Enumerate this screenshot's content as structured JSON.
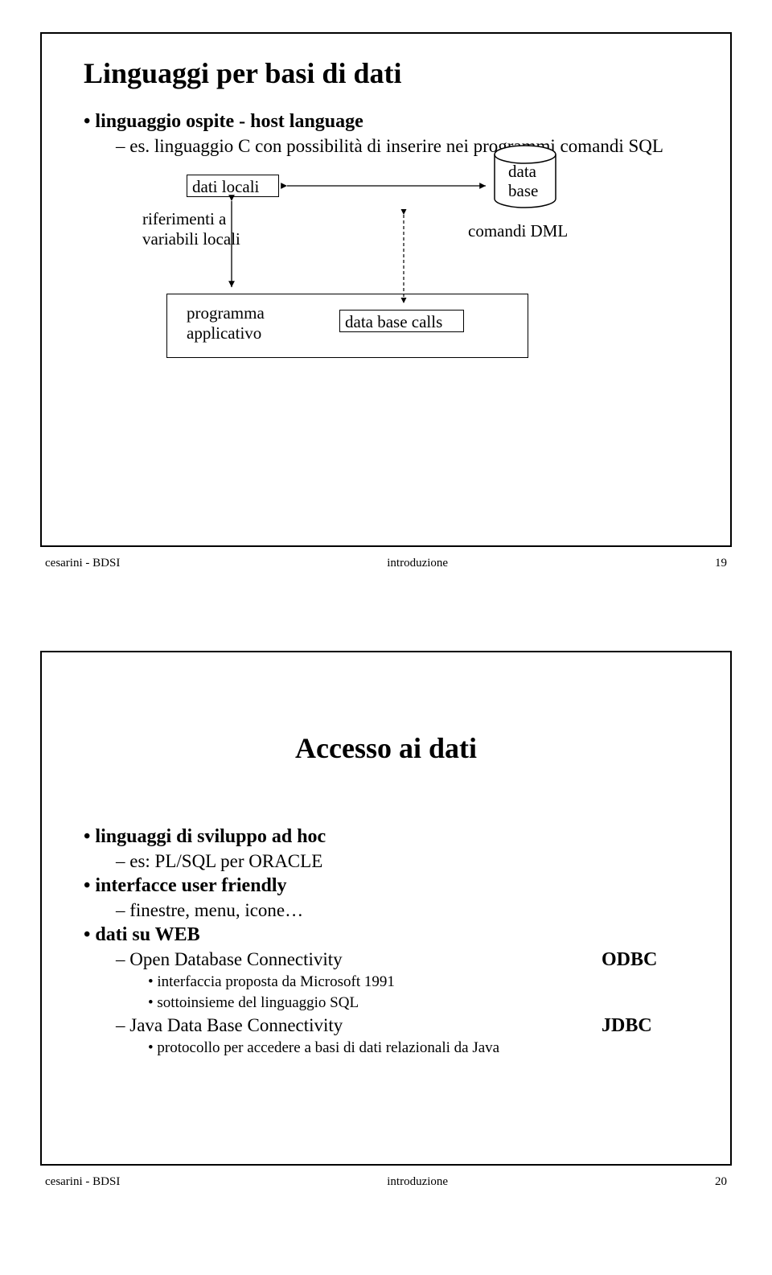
{
  "slide1": {
    "title": "Linguaggi per basi di dati",
    "bullet1": "linguaggio ospite - host language",
    "sub1": "es. linguaggio C con possibilità di inserire nei programmi comandi SQL",
    "diagram": {
      "dati_locali": "dati locali",
      "riferimenti_line1": "riferimenti a",
      "riferimenti_line2": "variabili locali",
      "data": "data",
      "base": "base",
      "comandi_dml": "comandi DML",
      "programma_line1": "programma",
      "programma_line2": "applicativo",
      "dbcalls": "data base calls"
    },
    "footer_left": "cesarini - BDSI",
    "footer_center": "introduzione",
    "footer_right": "19"
  },
  "slide2": {
    "title": "Accesso ai dati",
    "bullet_lang": "linguaggi di sviluppo ad hoc",
    "sub_plsql": "es: PL/SQL per ORACLE",
    "bullet_int": "interfacce user friendly",
    "sub_finestre": "finestre, menu, icone…",
    "bullet_web": "dati su WEB",
    "sub_odbc": "Open Database Connectivity",
    "odbc_abbr": "ODBC",
    "ss_ms": "interfaccia proposta da Microsoft 1991",
    "ss_sql": "sottoinsieme del linguaggio SQL",
    "sub_jdbc": "Java Data Base Connectivity",
    "jdbc_abbr": "JDBC",
    "ss_java": "protocollo per accedere a basi di dati relazionali da Java",
    "footer_left": "cesarini - BDSI",
    "footer_center": "introduzione",
    "footer_right": "20"
  }
}
